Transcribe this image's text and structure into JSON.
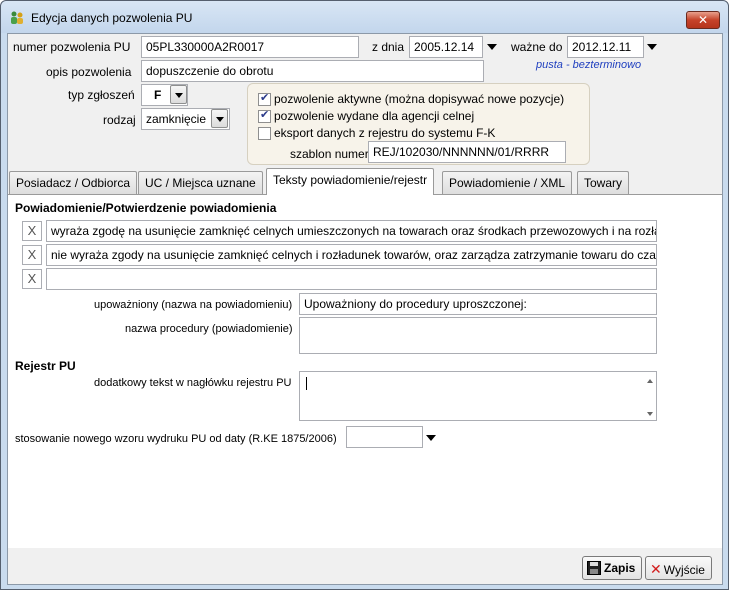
{
  "window": {
    "title": "Edycja danych pozwolenia PU",
    "close_label": "✕"
  },
  "header": {
    "permit_number_label": "numer pozwolenia PU",
    "permit_number_value": "05PL330000A2R0017",
    "date_from_label": "z dnia",
    "date_from_value": "2005.12.14",
    "valid_until_label": "ważne do",
    "valid_until_value": "2012.12.11",
    "valid_until_hint": "pusta - bezterminowo",
    "description_label": "opis pozwolenia",
    "description_value": "dopuszczenie do obrotu",
    "declaration_type_label": "typ zgłoszeń",
    "declaration_type_value": "F",
    "kind_label": "rodzaj",
    "kind_value": "zamknięcie"
  },
  "options": {
    "active_label": "pozwolenie aktywne (można dopisywać nowe pozycje)",
    "active_checked": true,
    "customs_label": "pozwolenie wydane dla agencji celnej",
    "customs_checked": true,
    "export_label": "eksport danych z rejestru do systemu F-K",
    "export_checked": false,
    "template_label": "szablon numeru",
    "template_value": "REJ/102030/NNNNNN/01/RRRR"
  },
  "tabs": [
    {
      "label": "Posiadacz / Odbiorca",
      "active": false
    },
    {
      "label": "UC / Miejsca uznane",
      "active": false
    },
    {
      "label": "Teksty powiadomienie/rejestr",
      "active": true
    },
    {
      "label": "Powiadomienie / XML",
      "active": false
    },
    {
      "label": "Towary",
      "active": false
    }
  ],
  "notifications": {
    "section_title": "Powiadomienie/Potwierdzenie powiadomienia",
    "rows": [
      {
        "x_label": "X",
        "text": "wyraża zgodę na usunięcie zamknięć celnych umieszczonych na towarach oraz środkach przewozowych i na rozładunek towarów"
      },
      {
        "x_label": "X",
        "text": "nie wyraża zgody na usunięcie zamknięć celnych i rozładunek towarów, oraz zarządza zatrzymanie towaru do czasu"
      },
      {
        "x_label": "X",
        "text": ""
      }
    ],
    "authorized_label": "upoważniony (nazwa na powiadomieniu)",
    "authorized_value": "Upoważniony do procedury uproszczonej:",
    "procedure_label": "nazwa procedury (powiadomienie)",
    "procedure_value": ""
  },
  "register": {
    "section_title": "Rejestr PU",
    "header_text_label": "dodatkowy tekst w nagłówku rejestru PU",
    "header_text_value": "",
    "new_form_label": "stosowanie nowego wzoru wydruku PU od daty (R.KE 1875/2006)",
    "new_form_value": ""
  },
  "footer": {
    "save_label": "Zapis",
    "exit_label": "Wyjście"
  },
  "colors": {
    "hint_color": "#1f3fbf",
    "window_frame": "#c9dbee",
    "close_button": "#c6432a"
  },
  "icons": {
    "app": "people-icon",
    "save": "floppy-disk-icon",
    "exit": "red-x-icon"
  }
}
